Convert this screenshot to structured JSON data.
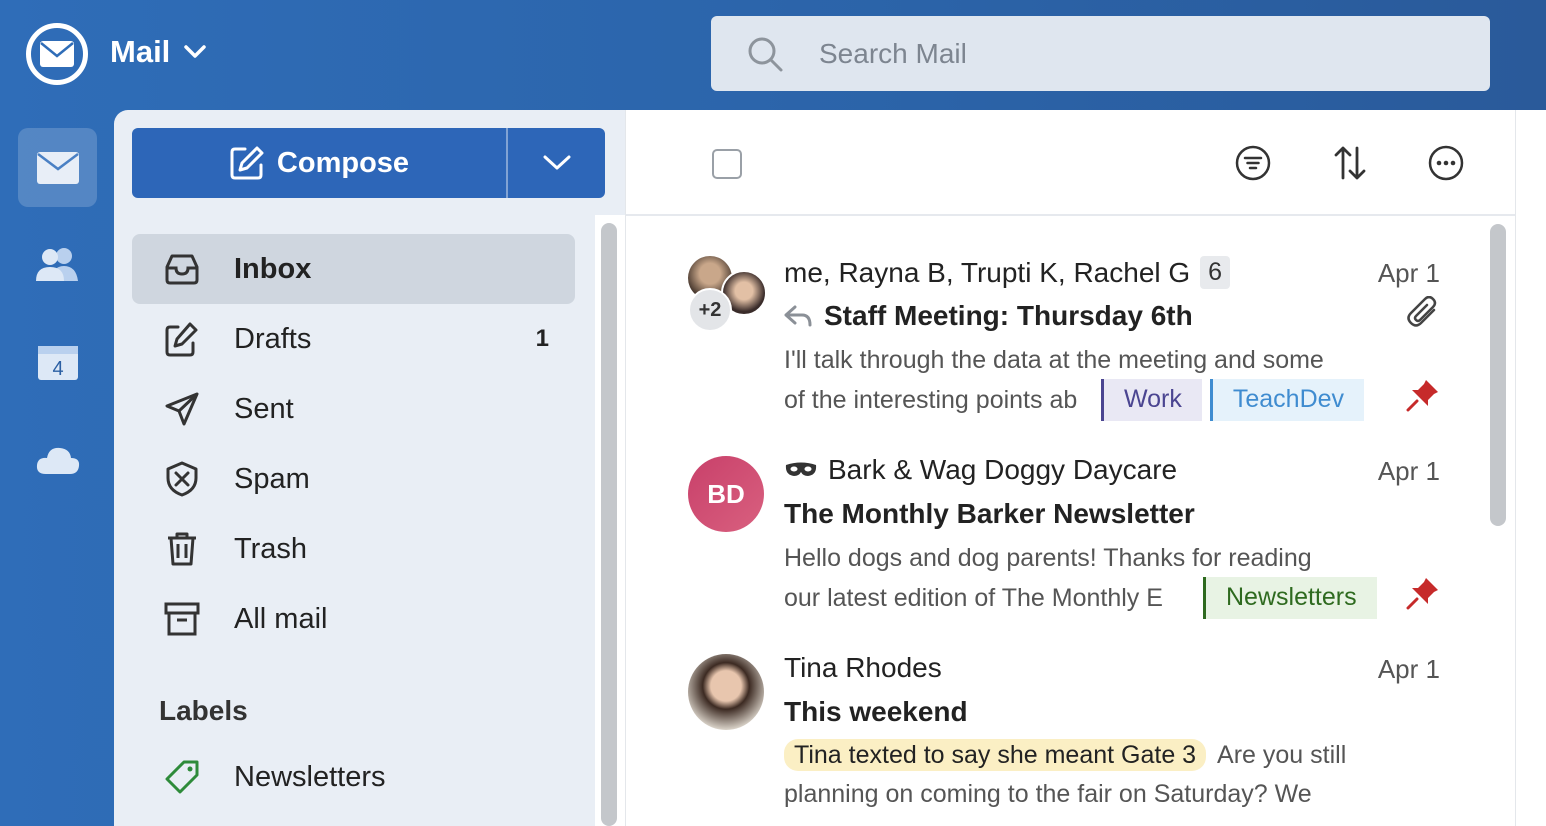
{
  "app": {
    "title": "Mail"
  },
  "search": {
    "placeholder": "Search Mail"
  },
  "rail": {
    "calendar_day": "4"
  },
  "compose": {
    "label": "Compose"
  },
  "folders": [
    {
      "name": "Inbox",
      "count": ""
    },
    {
      "name": "Drafts",
      "count": "1"
    },
    {
      "name": "Sent",
      "count": ""
    },
    {
      "name": "Spam",
      "count": ""
    },
    {
      "name": "Trash",
      "count": ""
    },
    {
      "name": "All mail",
      "count": ""
    }
  ],
  "labels": {
    "heading": "Labels",
    "items": [
      {
        "name": "Newsletters",
        "color": "#2e8b3a"
      }
    ]
  },
  "messages": [
    {
      "from": "me, Rayna B, Trupti K, Rachel G",
      "thread_count": "6",
      "date": "Apr 1",
      "subject": "Staff Meeting: Thursday 6th",
      "preview_line1": "I'll talk through the data at the meeting and some",
      "preview_line2": "of the interesting points ab",
      "extra_participants": "+2",
      "tags": [
        "Work",
        "TeachDev"
      ],
      "pinned": true,
      "has_attachment": true,
      "replied": true
    },
    {
      "from": "Bark & Wag Doggy Daycare",
      "date": "Apr 1",
      "subject": "The Monthly Barker Newsletter",
      "preview_line1": "Hello dogs and dog parents! Thanks for reading",
      "preview_line2": "our latest edition of The Monthly E",
      "avatar_initials": "BD",
      "tags": [
        "Newsletters"
      ],
      "pinned": true
    },
    {
      "from": "Tina Rhodes",
      "date": "Apr 1",
      "subject": "This weekend",
      "highlight": "Tina texted to say she meant Gate 3",
      "preview_line1": "Are you still",
      "preview_line2": "planning on coming to the fair on Saturday? We"
    }
  ],
  "colors": {
    "brand": "#2d66b8",
    "pin": "#c62a2a"
  }
}
